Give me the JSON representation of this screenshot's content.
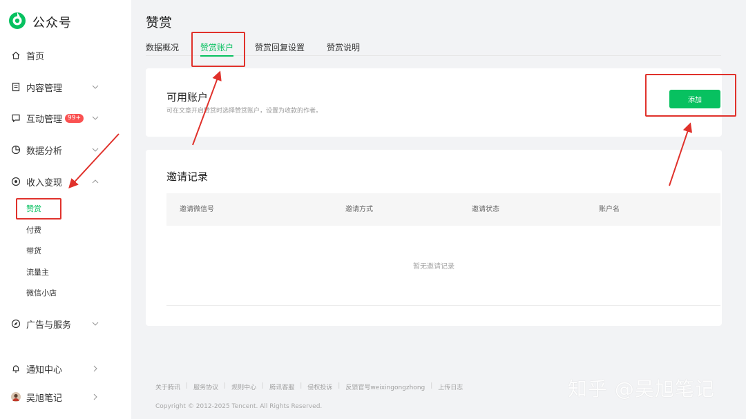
{
  "sidebar": {
    "logo_text": "公众号",
    "items": [
      {
        "label": "首页",
        "icon": "home-icon"
      },
      {
        "label": "内容管理",
        "icon": "document-icon"
      },
      {
        "label": "互动管理",
        "icon": "chat-icon",
        "badge": "99+"
      },
      {
        "label": "数据分析",
        "icon": "pie-chart-icon"
      },
      {
        "label": "收入变现",
        "icon": "coin-icon"
      },
      {
        "label": "广告与服务",
        "icon": "compass-icon"
      },
      {
        "label": "通知中心",
        "icon": "bell-icon"
      },
      {
        "label": "吴旭笔记",
        "icon": "avatar"
      }
    ],
    "sub_items": [
      "赞赏",
      "付费",
      "带货",
      "流量主",
      "微信小店"
    ]
  },
  "header": {
    "title": "赞赏",
    "tabs": [
      "数据概况",
      "赞赏账户",
      "赞赏回复设置",
      "赞赏说明"
    ],
    "active_tab": "赞赏账户"
  },
  "accounts": {
    "title": "可用账户",
    "description": "可在文章开启赞赏时选择赞赏账户，设置为收款的作者。",
    "add_button": "添加"
  },
  "invites": {
    "title": "邀请记录",
    "columns": [
      "邀请微信号",
      "邀请方式",
      "邀请状态",
      "账户名"
    ],
    "empty_text": "暂无邀请记录"
  },
  "footer": {
    "links": [
      "关于腾讯",
      "服务协议",
      "规则中心",
      "腾讯客服",
      "侵权投诉",
      "反馈官号weixingongzhong",
      "上传日志"
    ],
    "copyright": "Copyright © 2012-2025 Tencent. All Rights Reserved."
  },
  "watermark": "知乎 @吴旭笔记",
  "colors": {
    "accent": "#07c160",
    "badge": "#fa5151",
    "annotation": "#e0312b"
  }
}
